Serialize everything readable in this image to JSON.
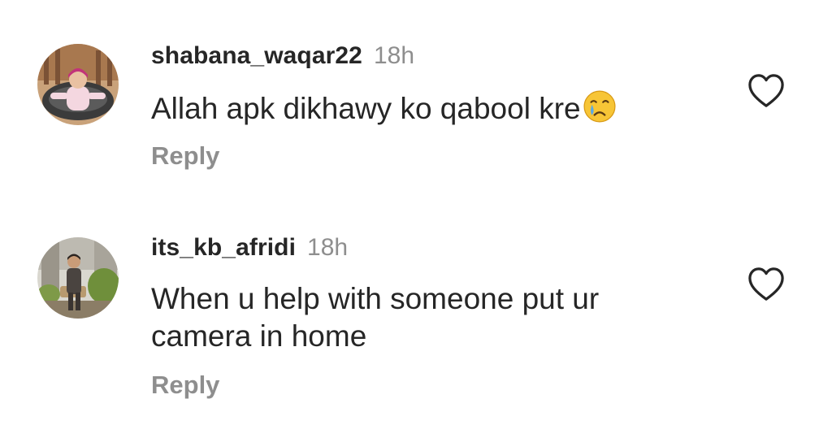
{
  "comments": [
    {
      "username": "shabana_waqar22",
      "time": "18h",
      "text": "Allah apk dikhawy ko qabool kre",
      "emoji": "crying-face-emoji",
      "reply_label": "Reply"
    },
    {
      "username": "its_kb_afridi",
      "time": "18h",
      "text": "When u help with someone put ur camera in home",
      "reply_label": "Reply"
    }
  ],
  "icons": {
    "like": "heart-outline-icon"
  },
  "colors": {
    "text_primary": "#262626",
    "text_secondary": "#8e8e8e",
    "background": "#ffffff"
  }
}
